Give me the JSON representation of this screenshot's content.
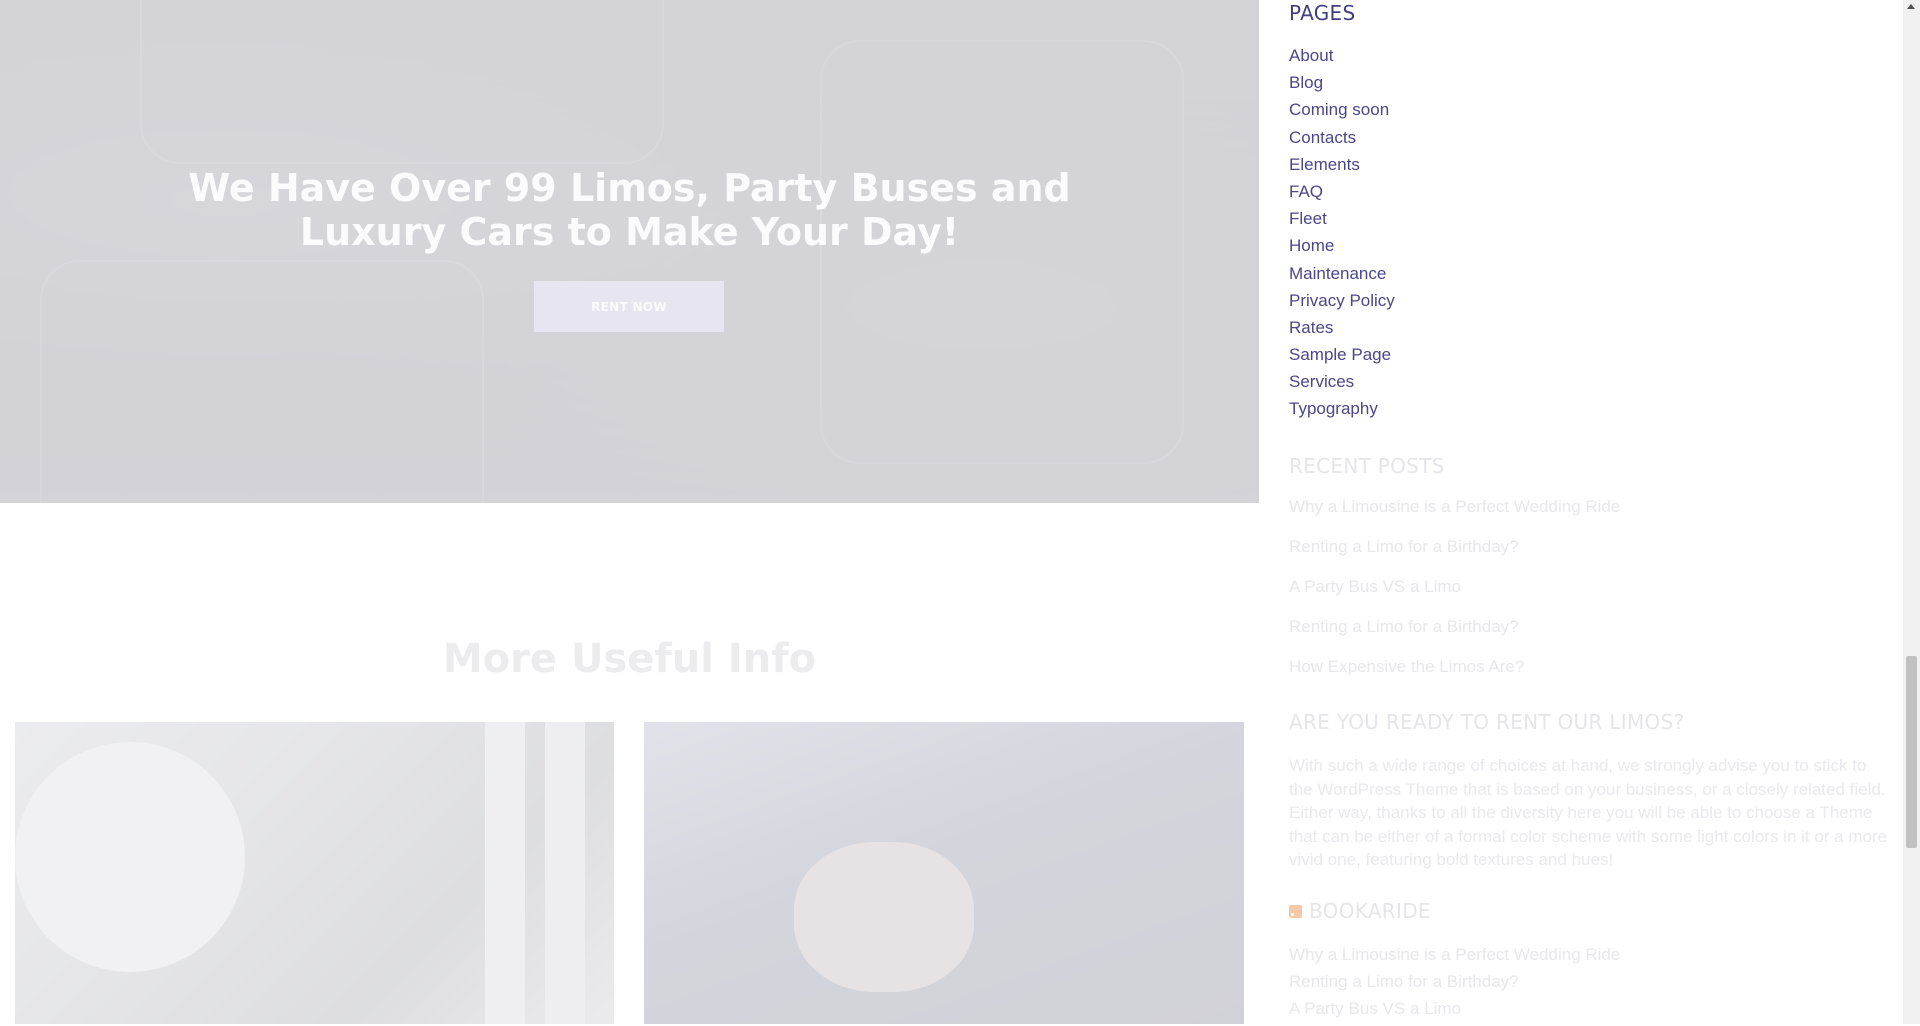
{
  "hero": {
    "title_line1": "We Have Over 99 Limos, Party Buses and",
    "title_line2": "Luxury Cars to Make Your Day!",
    "button_label": "RENT NOW"
  },
  "info": {
    "title": "More Useful Info"
  },
  "sidebar": {
    "pages": {
      "title": "PAGES",
      "items": [
        "About",
        "Blog",
        "Coming soon",
        "Contacts",
        "Elements",
        "FAQ",
        "Fleet",
        "Home",
        "Maintenance",
        "Privacy Policy",
        "Rates",
        "Sample Page",
        "Services",
        "Typography"
      ]
    },
    "recent_posts": {
      "title": "RECENT POSTS",
      "items": [
        "Why a Limousine is a Perfect Wedding Ride",
        "Renting a Limo for a Birthday?",
        "A Party Bus VS a Limo",
        "Renting a Limo for a Birthday?",
        "How Expensive the Limos Are?"
      ]
    },
    "ready": {
      "title": "ARE YOU READY TO RENT OUR LIMOS?",
      "text": "With such a wide range of choices at hand, we strongly advise you to stick to the WordPress Theme that is based on your business, or a closely related field. Either way, thanks to all the diversity here you will be able to choose a Theme that can be either of a formal color scheme with some light colors in it or a more vivid one, featuring bold textures and hues!"
    },
    "bookaride": {
      "title": "BOOKARIDE",
      "items": [
        "Why a Limousine is a Perfect Wedding Ride",
        "Renting a Limo for a Birthday?",
        "A Party Bus VS a Limo"
      ]
    }
  },
  "colors": {
    "accent": "#413f80",
    "link": "#4a478a",
    "rss": "#f6c8a8"
  }
}
